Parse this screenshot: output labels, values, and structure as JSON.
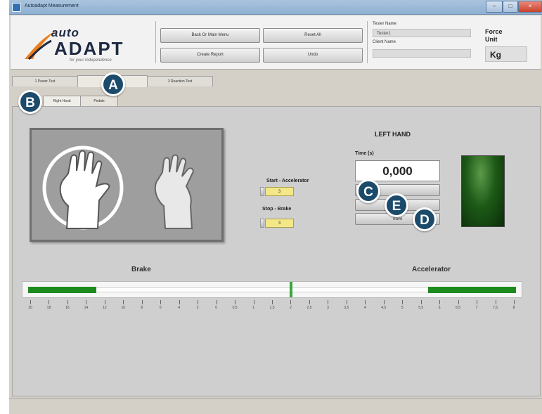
{
  "window": {
    "title": "Autoadapt Measurement",
    "controls": {
      "minimize": "–",
      "maximize": "□",
      "close": "×"
    }
  },
  "logo": {
    "brand_top": "auto",
    "brand_main": "ADAPT",
    "tagline": "for your independence"
  },
  "header_buttons": {
    "back": "Back Or Main Menu",
    "reset_all": "Reset All",
    "create_report": "Create Report",
    "undo": "Undo"
  },
  "header_fields": {
    "tester_label": "Tester Name",
    "tester_value": "Tester1",
    "client_label": "Client Name",
    "client_value": ""
  },
  "force_unit": {
    "label_line1": "Force",
    "label_line2": "Unit",
    "value": "Kg"
  },
  "tabs": [
    {
      "label": "1 Power Test"
    },
    {
      "label": ""
    },
    {
      "label": "3 Reaction Test"
    }
  ],
  "subtabs": [
    {
      "label": "Right Hand"
    },
    {
      "label": "Pedals"
    }
  ],
  "controls": {
    "start_label": "Start - Accelerator",
    "start_value": "3",
    "stop_label": "Stop - Brake",
    "stop_value": "3"
  },
  "side": {
    "title": "LEFT HAND",
    "time_label": "Time (s)",
    "time_value": "0,000",
    "btn_top": "",
    "btn_mid": "",
    "btn_bottom": "Save"
  },
  "slider": {
    "brake_label": "Brake",
    "accelerator_label": "Accelerator",
    "brake_fill_fraction": 0.14,
    "accelerator_fill_fraction": 0.18,
    "ticks": [
      "20",
      "18",
      "16",
      "14",
      "12",
      "10",
      "8",
      "6",
      "4",
      "2",
      "0",
      "0,5",
      "1",
      "1,5",
      "2",
      "2,5",
      "3",
      "3,5",
      "4",
      "4,5",
      "5",
      "5,5",
      "6",
      "6,5",
      "7",
      "7,5",
      "8"
    ]
  },
  "markers": [
    "A",
    "B",
    "C",
    "D",
    "E"
  ],
  "colors": {
    "led": "#1d5a17",
    "fill": "#1e8a1e",
    "marker": "#1b4a6b",
    "indicator": "#f3e788"
  }
}
